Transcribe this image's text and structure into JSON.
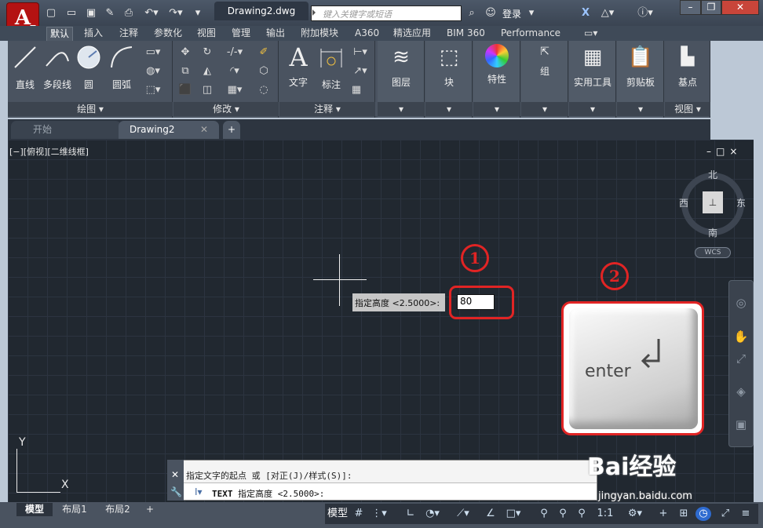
{
  "app": {
    "logo_letter": "A",
    "doc_title": "Drawing2.dwg"
  },
  "search": {
    "placeholder": "键入关键字或短语"
  },
  "account": {
    "login_label": "登录"
  },
  "ribbon_tabs": [
    "默认",
    "插入",
    "注释",
    "参数化",
    "视图",
    "管理",
    "输出",
    "附加模块",
    "A360",
    "精选应用",
    "BIM 360",
    "Performance"
  ],
  "draw_panel": {
    "tools": [
      "直线",
      "多段线",
      "圆",
      "圆弧"
    ],
    "title": "绘图 ▾"
  },
  "modify_panel": {
    "title": "修改 ▾"
  },
  "annot_panel": {
    "tools": [
      "文字",
      "标注"
    ],
    "title": "注释 ▾"
  },
  "big_tools": [
    "图层",
    "块",
    "特性",
    "组",
    "实用工具",
    "剪贴板",
    "基点"
  ],
  "view_panel": {
    "title": "视图 ▾"
  },
  "file_tabs": {
    "start": "开始",
    "drawing": "Drawing2",
    "add": "+"
  },
  "viewport": {
    "label": "[−][俯视][二维线框]",
    "controls": "–□×"
  },
  "compass": {
    "north": "北",
    "south": "南",
    "east": "东",
    "west": "西",
    "wcs": "WCS"
  },
  "dyn_input": {
    "prompt": "指定高度 <2.5000>:",
    "value": "80"
  },
  "annotations": {
    "step1": "1",
    "step2": "2",
    "key_label": "enter"
  },
  "ucs": {
    "x": "X",
    "y": "Y"
  },
  "command": {
    "history": "指定文字的起点 或 [对正(J)/样式(S)]:",
    "current_cmd": "TEXT",
    "current": "指定高度 <2.5000>:"
  },
  "layout_tabs": [
    "模型",
    "布局1",
    "布局2"
  ],
  "status": {
    "model": "模型",
    "scale": "1:1"
  },
  "watermark": {
    "brand": "Bai经验",
    "url": "jingyan.baidu.com"
  },
  "colors": {
    "canvas": "#212830",
    "highlight": "#e12424",
    "app_red": "#b41212"
  }
}
